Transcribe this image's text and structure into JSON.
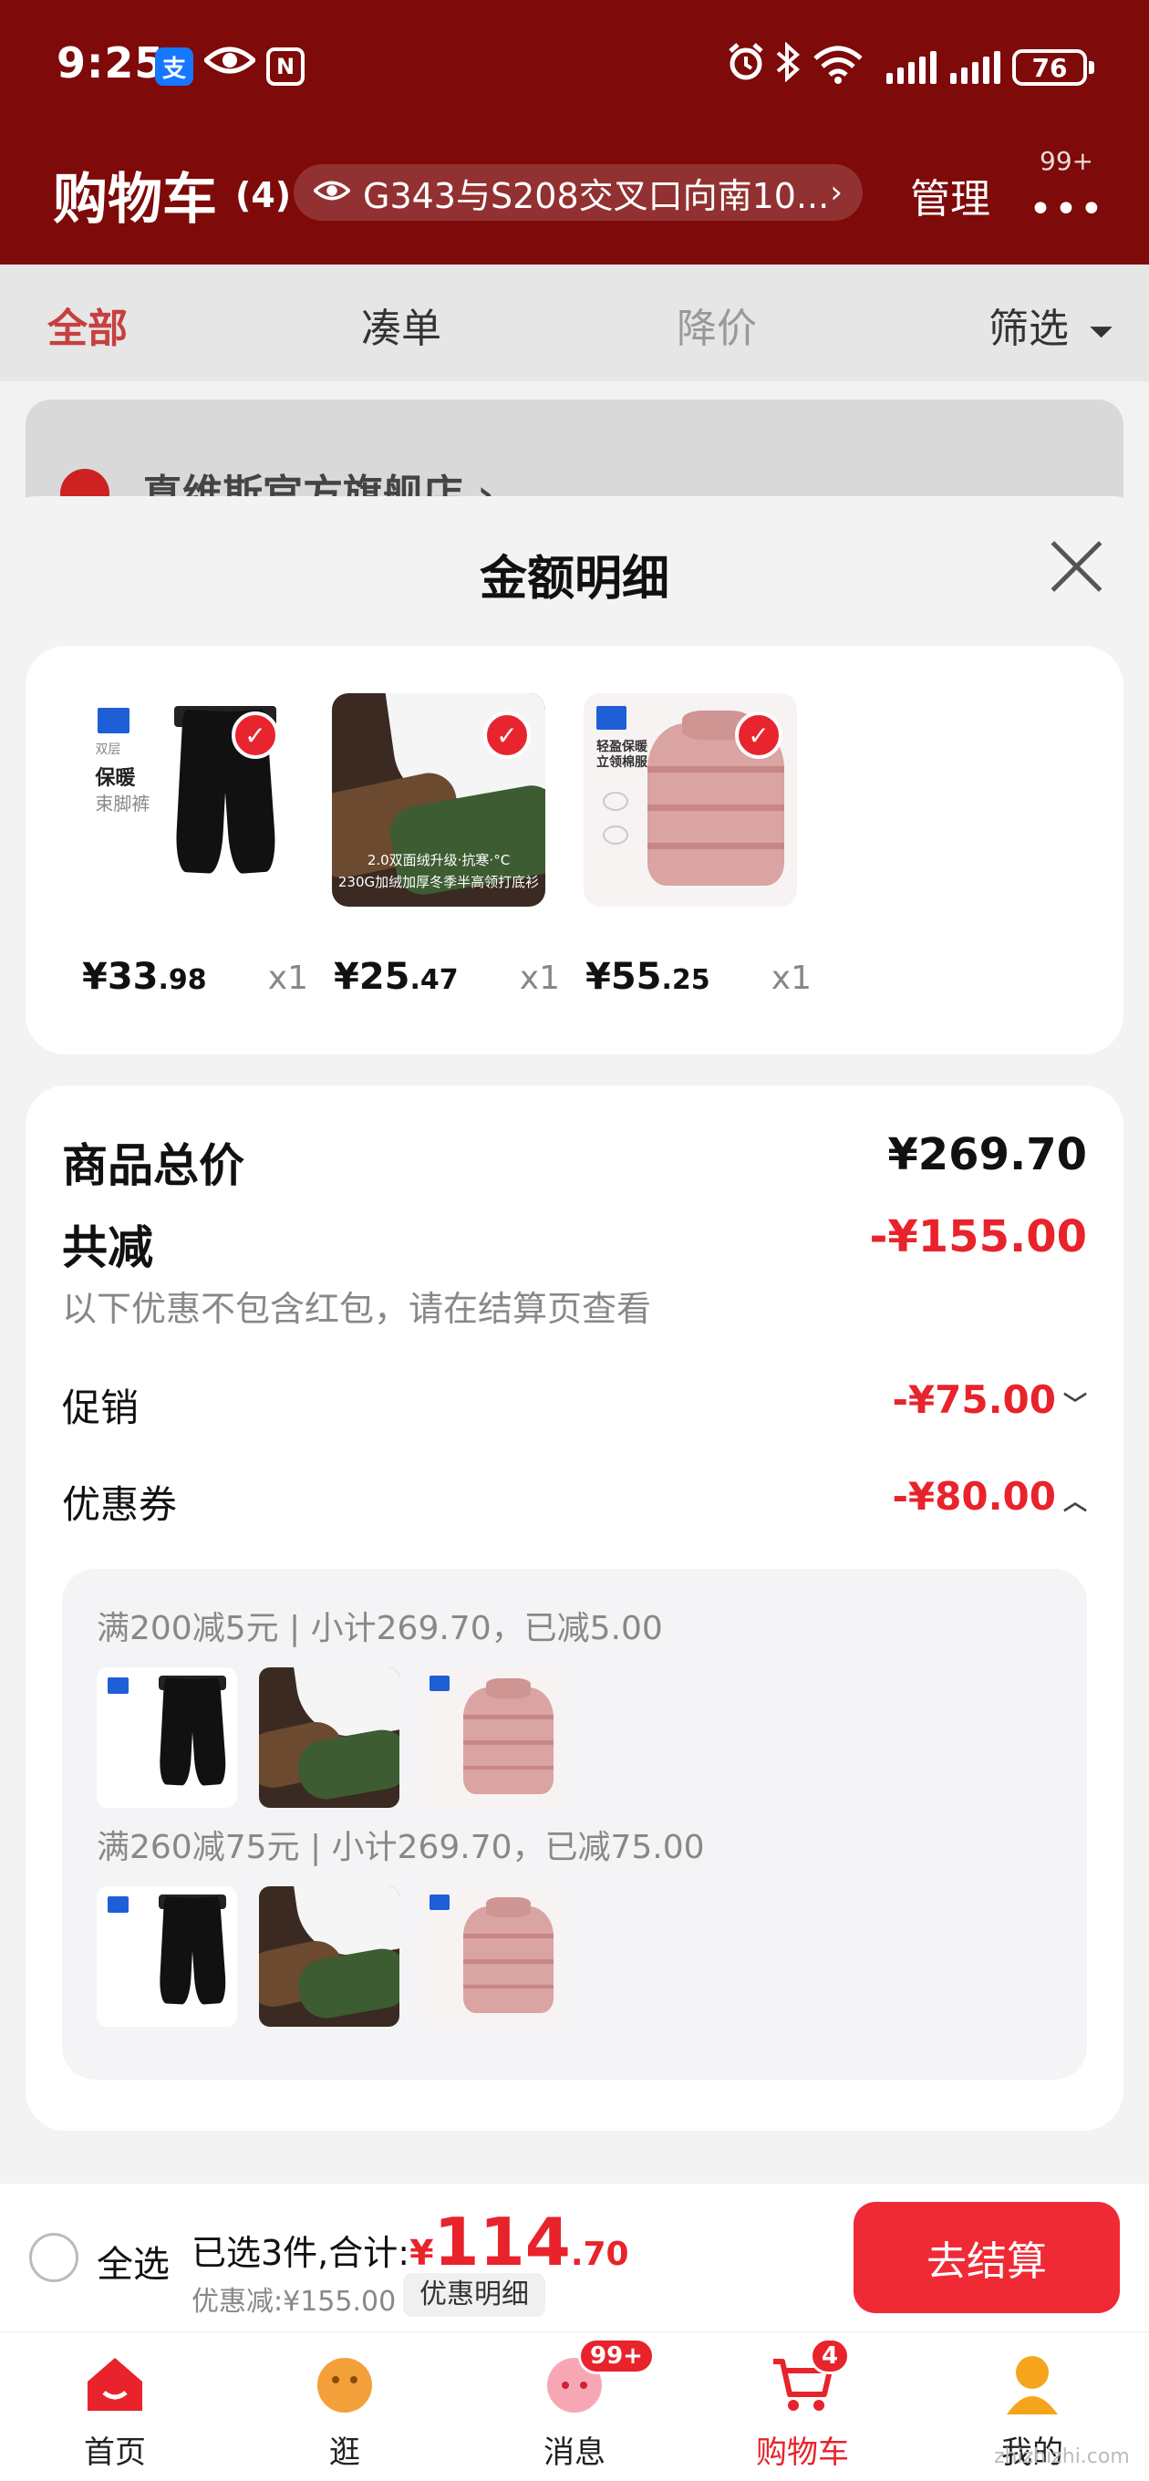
{
  "status_bar": {
    "time": "9:25",
    "alipay_icon": "支",
    "nfc_icon": "N",
    "battery": "76"
  },
  "header": {
    "title": "购物车",
    "count": "(4)",
    "address": "G343与S208交叉口向南10...",
    "manage": "管理",
    "badge": "99+"
  },
  "tabs": [
    {
      "label": "全部"
    },
    {
      "label": "凑单"
    },
    {
      "label": "降价"
    },
    {
      "label": "筛选"
    }
  ],
  "store": {
    "name": "真维斯官方旗舰店 ›"
  },
  "sheet": {
    "title": "金额明细",
    "products": [
      {
        "price_int": "¥33",
        "price_dec": ".98",
        "qty": "x1",
        "kind": "pants"
      },
      {
        "price_int": "¥25",
        "price_dec": ".47",
        "qty": "x1",
        "kind": "tee"
      },
      {
        "price_int": "¥55",
        "price_dec": ".25",
        "qty": "x1",
        "kind": "jacket"
      }
    ],
    "product_art": {
      "pants_text": [
        "双层",
        "保暖",
        "束脚裤"
      ],
      "tee_caption_1": "2.0双面绒升级·抗寒·°C",
      "tee_caption_2": "230G加绒加厚冬季半高领打底衫",
      "jacket_text": [
        "轻盈保暖",
        "立领棉服"
      ]
    },
    "summary": {
      "total_label": "商品总价",
      "total_value": "¥269.70",
      "reduce_label": "共减",
      "reduce_value": "-¥155.00",
      "reduce_note": "以下优惠不包含红包，请在结算页查看",
      "promo_label": "促销",
      "promo_value": "-¥75.00",
      "coupon_label": "优惠券",
      "coupon_value": "-¥80.00",
      "coupons": [
        {
          "text": "满200减5元 | 小计269.70，已减5.00"
        },
        {
          "text": "满260减75元 | 小计269.70，已减75.00"
        }
      ]
    }
  },
  "checkout": {
    "select_all": "全选",
    "selected_prefix": "已选3件,合计:",
    "total_yen": "¥",
    "total_int": "114",
    "total_dec": ".70",
    "discount": "优惠减:¥155.00",
    "detail_chip": "优惠明细",
    "button": "去结算"
  },
  "tabbar": [
    {
      "label": "首页",
      "icon": "home-icon"
    },
    {
      "label": "逛",
      "icon": "browse-icon"
    },
    {
      "label": "消息",
      "icon": "message-icon",
      "badge": "99+"
    },
    {
      "label": "购物车",
      "icon": "cart-icon",
      "badge": "4",
      "active": true
    },
    {
      "label": "我的",
      "icon": "profile-icon"
    }
  ],
  "watermark": "zhizhizhi.com",
  "colors": {
    "header_red": "#7e0a0a",
    "accent_red": "#e8232b",
    "button_red": "#f02a35"
  }
}
